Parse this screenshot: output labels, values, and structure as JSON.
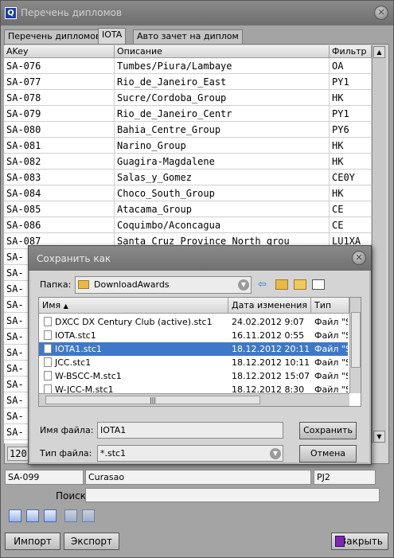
{
  "window": {
    "title": "Перечень дипломов",
    "tabs": [
      "Перечень дипломов",
      "IOTA",
      "Авто зачет на диплом"
    ]
  },
  "grid": {
    "columns": [
      "AKey",
      "Описание",
      "Фильтр"
    ],
    "rows": [
      {
        "akey": "SA-076",
        "desc": "Tumbes/Piura/Lambaye",
        "filter": "OA"
      },
      {
        "akey": "SA-077",
        "desc": "Rio_de_Janeiro_East",
        "filter": "PY1"
      },
      {
        "akey": "SA-078",
        "desc": "Sucre/Cordoba_Group",
        "filter": "HK"
      },
      {
        "akey": "SA-079",
        "desc": "Rio_de_Janeiro_Centr",
        "filter": "PY1"
      },
      {
        "akey": "SA-080",
        "desc": "Bahia_Centre_Group",
        "filter": "PY6"
      },
      {
        "akey": "SA-081",
        "desc": "Narino_Group",
        "filter": "HK"
      },
      {
        "akey": "SA-082",
        "desc": "Guagira-Magdalene",
        "filter": "HK"
      },
      {
        "akey": "SA-083",
        "desc": "Salas_y_Gomez",
        "filter": "CE0Y"
      },
      {
        "akey": "SA-084",
        "desc": "Choco_South_Group",
        "filter": "HK"
      },
      {
        "akey": "SA-085",
        "desc": "Atacama_Group",
        "filter": "CE"
      },
      {
        "akey": "SA-086",
        "desc": "Coquimbo/Aconcagua",
        "filter": "CE"
      },
      {
        "akey": "SA-087",
        "desc": "Santa Cruz Province North grou",
        "filter": "LU1XA"
      },
      {
        "akey": "SA-",
        "desc": "",
        "filter": ""
      },
      {
        "akey": "SA-",
        "desc": "",
        "filter": ""
      },
      {
        "akey": "SA-",
        "desc": "",
        "filter": ""
      },
      {
        "akey": "SA-",
        "desc": "",
        "filter": ""
      },
      {
        "akey": "SA-",
        "desc": "",
        "filter": ""
      },
      {
        "akey": "SA-",
        "desc": "",
        "filter": ""
      },
      {
        "akey": "SA-",
        "desc": "",
        "filter": ""
      },
      {
        "akey": "SA-",
        "desc": "",
        "filter": ""
      },
      {
        "akey": "SA-",
        "desc": "",
        "filter": ""
      },
      {
        "akey": "SA-",
        "desc": "",
        "filter": ""
      },
      {
        "akey": "SA-",
        "desc": "",
        "filter": ""
      },
      {
        "akey": "SA-",
        "desc": "",
        "filter": ""
      }
    ],
    "count_label": "120"
  },
  "details": {
    "akey": "SA-099",
    "name": "Curasao",
    "prefix": "PJ2",
    "search_label": "Поиск",
    "search_value": ""
  },
  "buttons": {
    "import": "Импорт",
    "export": "Экспорт",
    "close": "Закрыть"
  },
  "save_dialog": {
    "title": "Сохранить как",
    "folder_label": "Папка:",
    "folder_value": "DownloadAwards",
    "columns": [
      "Имя",
      "Дата изменения",
      "Тип"
    ],
    "files": [
      {
        "name": "DXCC DX Century Club (active).stc1",
        "date": "24.02.2012 9:07",
        "type": "Файл \"S"
      },
      {
        "name": "IOTA.stc1",
        "date": "16.11.2012 0:55",
        "type": "Файл \"S"
      },
      {
        "name": "IOTA1.stc1",
        "date": "18.12.2012 20:11",
        "type": "Файл \"S"
      },
      {
        "name": "JCC.stc1",
        "date": "18.12.2012 10:11",
        "type": "Файл \"S"
      },
      {
        "name": "W-BSCC-M.stc1",
        "date": "18.12.2012 15:07",
        "type": "Файл \"S"
      },
      {
        "name": "W-JCC-M.stc1",
        "date": "18.12.2012 8:30",
        "type": "Файл \"S"
      }
    ],
    "selected_file_index": 2,
    "filename_label": "Имя файла:",
    "filename_value": "IOTA1",
    "filetype_label": "Тип файла:",
    "filetype_value": "*.stc1",
    "save_button": "Сохранить",
    "cancel_button": "Отмена"
  },
  "colors": {
    "selection": "#3f78c8",
    "chrome": "#a4a4a4"
  }
}
